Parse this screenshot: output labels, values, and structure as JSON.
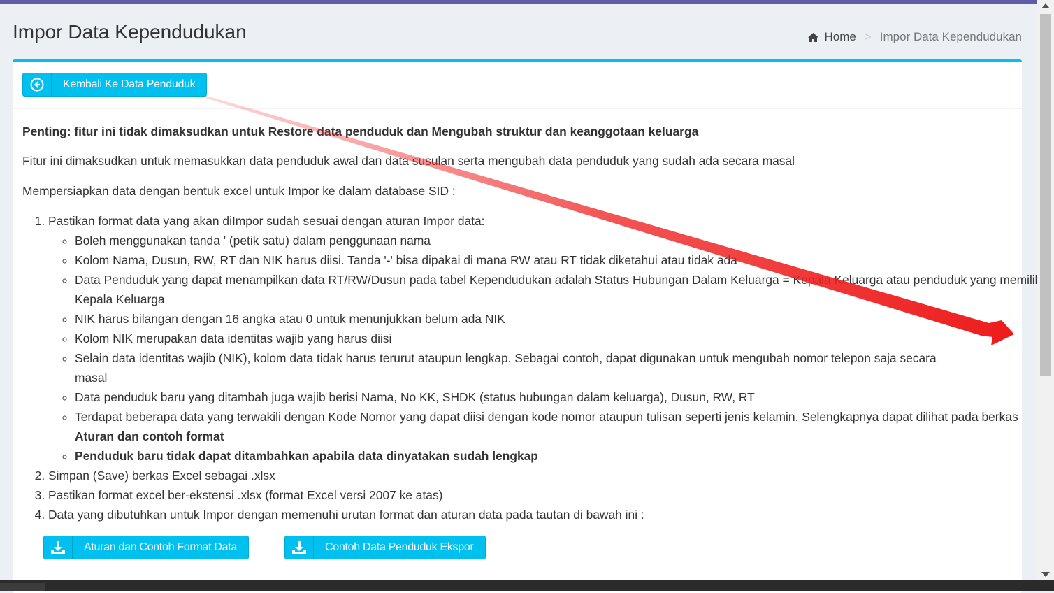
{
  "header": {
    "title": "Impor Data Kependudukan",
    "breadcrumb": {
      "home": "Home",
      "current": "Impor Data Kependudukan"
    }
  },
  "toolbar": {
    "back_label": "Kembali Ke Data Penduduk"
  },
  "content": {
    "important": "Penting: fitur ini tidak dimaksudkan untuk Restore data penduduk dan Mengubah struktur dan keanggotaan keluarga",
    "intro": "Fitur ini dimaksudkan untuk memasukkan data penduduk awal dan data susulan serta mengubah data penduduk yang sudah ada secara masal",
    "prepare": "Mempersiapkan data dengan bentuk excel untuk Impor ke dalam database SID :",
    "steps": [
      "Pastikan format data yang akan diImpor sudah sesuai dengan aturan Impor data:",
      "Simpan (Save) berkas Excel sebagai .xlsx",
      "Pastikan format excel ber-ekstensi .xlsx (format Excel versi 2007 ke atas)",
      "Data yang dibutuhkan untuk Impor dengan memenuhi urutan format dan aturan data pada tautan di bawah ini :"
    ],
    "rules": [
      "Boleh menggunakan tanda ' (petik satu) dalam penggunaan nama",
      "Kolom Nama, Dusun, RW, RT dan NIK harus diisi. Tanda '-' bisa dipakai di mana RW atau RT tidak diketahui atau tidak ada",
      "Data Penduduk yang dapat menampilkan data RT/RW/Dusun pada tabel Kependudukan adalah Status Hubungan Dalam Keluarga = Kepala Keluarga atau penduduk yang memiliki Kepala Keluarga",
      "NIK harus bilangan dengan 16 angka atau 0 untuk menunjukkan belum ada NIK",
      "Kolom NIK merupakan data identitas wajib yang harus diisi",
      "Selain data identitas wajib (NIK), kolom data tidak harus terurut ataupun lengkap. Sebagai contoh, dapat digunakan untuk mengubah nomor telepon saja secara",
      "masal",
      "Data penduduk baru yang ditambah juga wajib berisi Nama, No KK, SHDK (status hubungan dalam keluarga), Dusun, RW, RT",
      "Terdapat beberapa data yang terwakili dengan Kode Nomor yang dapat diisi dengan kode nomor ataupun tulisan seperti jenis kelamin. Selengkapnya dapat dilihat pada berkas",
      "Aturan dan contoh format",
      "Penduduk baru tidak dapat ditambahkan apabila data dinyatakan sudah lengkap"
    ]
  },
  "downloads": {
    "rules_label": "Aturan dan Contoh Format Data",
    "export_label": "Contoh Data Penduduk Ekspor"
  },
  "colors": {
    "accent": "#00c0ef",
    "topbar": "#605ca8",
    "annotation_arrow": "#ee1c1c"
  }
}
